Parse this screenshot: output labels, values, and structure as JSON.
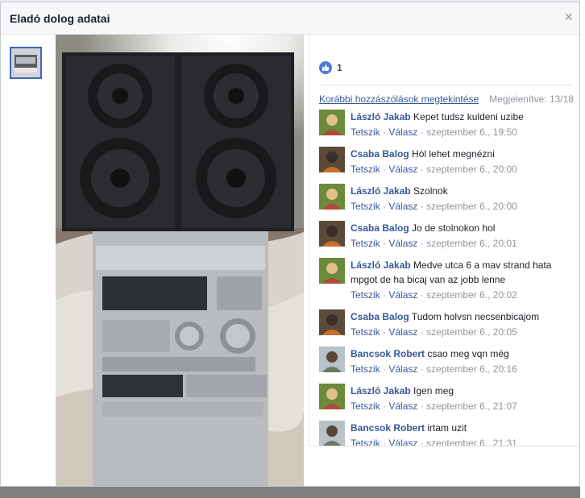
{
  "dialog": {
    "title": "Eladó dolog adatai",
    "close_symbol": "×"
  },
  "likes": {
    "count": "1",
    "icon": "thumbs-up-icon"
  },
  "comments_header": {
    "view_previous": "Korábbi hozzászólások megtekintése",
    "shown": "Megjelenítve: 13/18"
  },
  "actions": {
    "like": "Tetszik",
    "reply": "Válasz",
    "dot": "·"
  },
  "comments": [
    {
      "author": "László Jakab",
      "text": "Kepet tudsz kuldeni uzibe",
      "time": "szeptember 6., 19:50"
    },
    {
      "author": "Csaba Balog",
      "text": "Hól lehet megnézni",
      "time": "szeptember 6., 20:00"
    },
    {
      "author": "László Jakab",
      "text": "Szolnok",
      "time": "szeptember 6., 20:00"
    },
    {
      "author": "Csaba Balog",
      "text": "Jo de stolnokon hol",
      "time": "szeptember 6., 20:01"
    },
    {
      "author": "László Jakab",
      "text": "Medve utca 6 a mav strand hata mpgot de ha bicaj van az jobb lenne",
      "time": "szeptember 6., 20:02"
    },
    {
      "author": "Csaba Balog",
      "text": "Tudom holvsn necsenbicajom",
      "time": "szeptember 6., 20:05"
    },
    {
      "author": "Bancsok Robert",
      "text": "csao meg vqn még",
      "time": "szeptember 6., 20:16"
    },
    {
      "author": "László Jakab",
      "text": "Igen meg",
      "time": "szeptember 6., 21:07"
    },
    {
      "author": "Bancsok Robert",
      "text": "irtam uzit",
      "time": "szeptember 6., 21:31"
    }
  ]
}
